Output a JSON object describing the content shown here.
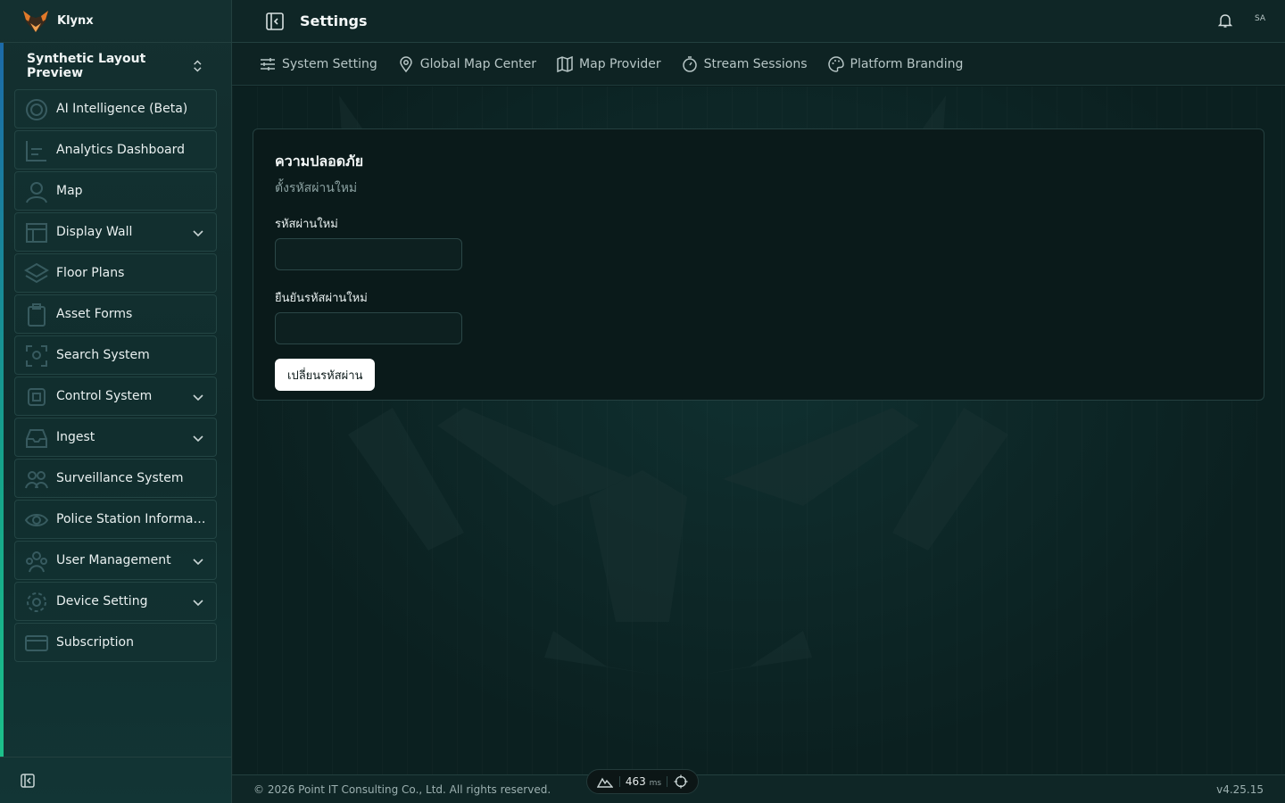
{
  "app": {
    "brand_name": "Klynx",
    "page_title": "Settings",
    "avatar_initials": "SA"
  },
  "sidebar": {
    "workspace": "Synthetic Layout Preview",
    "items": [
      {
        "label": "AI Intelligence (Beta)",
        "icon": "target-icon",
        "expandable": false
      },
      {
        "label": "Analytics Dashboard",
        "icon": "chart-icon",
        "expandable": false
      },
      {
        "label": "Map",
        "icon": "user-pin-icon",
        "expandable": false
      },
      {
        "label": "Display Wall",
        "icon": "layout-icon",
        "expandable": true
      },
      {
        "label": "Floor Plans",
        "icon": "layers-icon",
        "expandable": false
      },
      {
        "label": "Asset Forms",
        "icon": "clipboard-icon",
        "expandable": false
      },
      {
        "label": "Search System",
        "icon": "scan-icon",
        "expandable": false
      },
      {
        "label": "Control System",
        "icon": "chip-icon",
        "expandable": true
      },
      {
        "label": "Ingest",
        "icon": "inbox-icon",
        "expandable": true
      },
      {
        "label": "Surveillance System",
        "icon": "users-icon",
        "expandable": false
      },
      {
        "label": "Police Station Information",
        "icon": "eye-icon",
        "expandable": false
      },
      {
        "label": "User Management",
        "icon": "group-icon",
        "expandable": true
      },
      {
        "label": "Device Setting",
        "icon": "gear-icon",
        "expandable": true
      },
      {
        "label": "Subscription",
        "icon": "card-icon",
        "expandable": false
      }
    ]
  },
  "tabs": [
    {
      "label": "System Setting",
      "icon": "sliders-icon"
    },
    {
      "label": "Global Map Center",
      "icon": "location-pin-icon"
    },
    {
      "label": "Map Provider",
      "icon": "map-icon"
    },
    {
      "label": "Stream Sessions",
      "icon": "timer-icon"
    },
    {
      "label": "Platform Branding",
      "icon": "palette-icon"
    }
  ],
  "security_card": {
    "heading": "ความปลอดภัย",
    "subheading": "ตั้งรหัสผ่านใหม่",
    "new_password_label": "รหัสผ่านใหม่",
    "new_password_value": "",
    "confirm_password_label": "ยืนยันรหัสผ่านใหม่",
    "confirm_password_value": "",
    "submit_label": "เปลี่ยนรหัสผ่าน"
  },
  "footer": {
    "copyright": "© 2026 Point IT Consulting Co., Ltd. All rights reserved.",
    "version": "v4.25.15"
  },
  "dev_pill": {
    "latency": "463",
    "unit": "ms"
  },
  "colors": {
    "accent_blue": "#1c6aa8",
    "accent_green": "#1cc08a",
    "logo_orange": "#e07a2a"
  }
}
